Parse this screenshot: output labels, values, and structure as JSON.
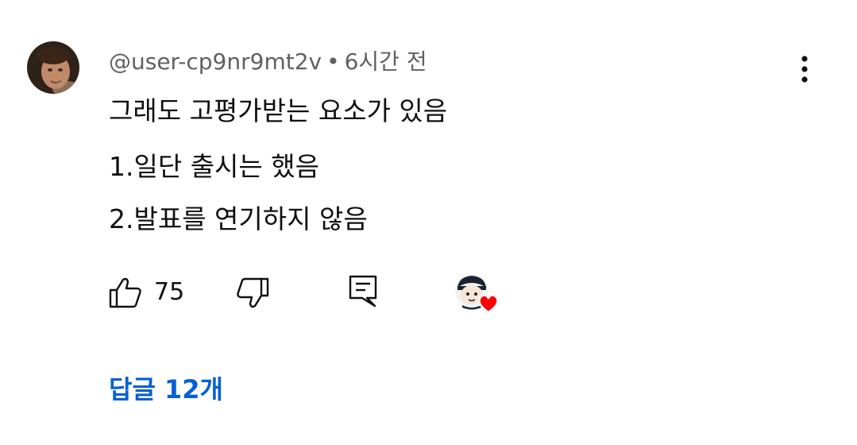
{
  "comment": {
    "author": "@user-cp9nr9mt2v",
    "separator": "•",
    "timestamp": "6시간 전",
    "lines": [
      "그래도 고평가받는 요소가 있음",
      "1.일단 출시는 했음",
      "2.발표를 연기하지 않음"
    ]
  },
  "actions": {
    "like_icon": "thumbs-up-icon",
    "like_count": "75",
    "dislike_icon": "thumbs-down-icon",
    "reply_icon": "comment-icon",
    "creator_heart_icon": "creator-heart-icon",
    "more_icon": "more-vert-icon"
  },
  "replies": {
    "label": "답글 12개"
  },
  "colors": {
    "meta_text": "#606060",
    "body_text": "#0f0f0f",
    "link": "#065fd4",
    "heart": "#ff0000"
  }
}
